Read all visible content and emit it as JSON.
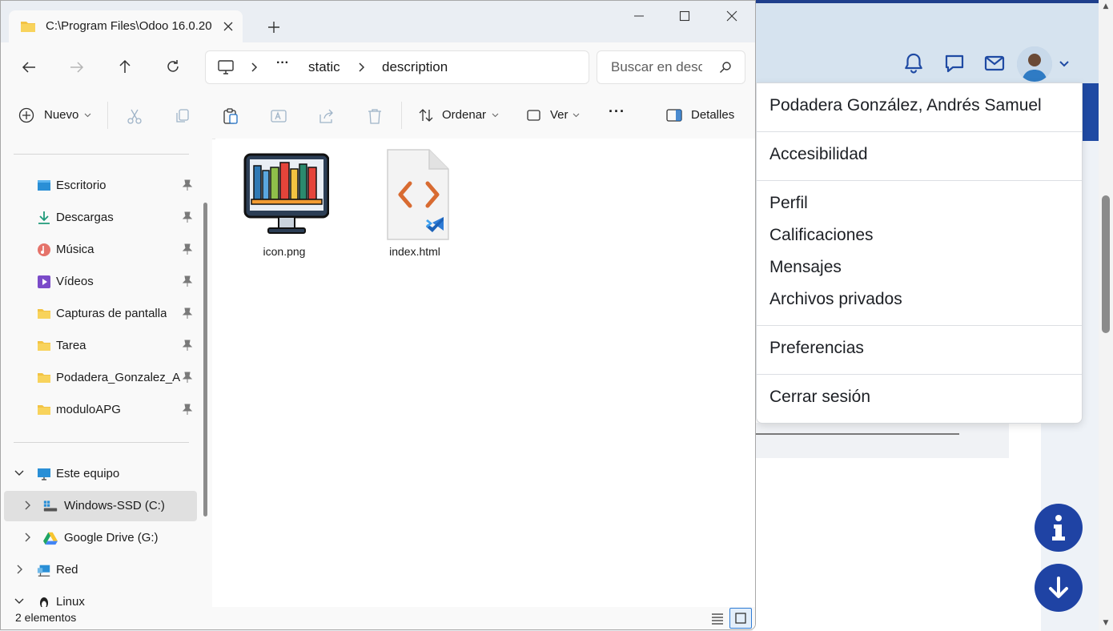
{
  "explorer": {
    "tab_title": "C:\\Program Files\\Odoo 16.0.20",
    "breadcrumb": [
      "static",
      "description"
    ],
    "breadcrumb_ellipsis": "···",
    "search_placeholder": "Buscar en desc",
    "toolbar": {
      "new": "Nuevo",
      "sort": "Ordenar",
      "view": "Ver",
      "more": "···",
      "details": "Detalles"
    },
    "quick_access": [
      {
        "label": "Escritorio",
        "icon": "desktop-icon"
      },
      {
        "label": "Descargas",
        "icon": "download-icon"
      },
      {
        "label": "Música",
        "icon": "music-icon"
      },
      {
        "label": "Vídeos",
        "icon": "video-icon"
      },
      {
        "label": "Capturas de pantalla",
        "icon": "folder-icon"
      },
      {
        "label": "Tarea",
        "icon": "folder-icon"
      },
      {
        "label": "Podadera_Gonzalez_Andres",
        "icon": "folder-icon"
      },
      {
        "label": "moduloAPG",
        "icon": "folder-icon"
      }
    ],
    "this_pc": "Este equipo",
    "drives": [
      {
        "label": "Windows-SSD (C:)",
        "icon": "windows-drive-icon",
        "selected": true
      },
      {
        "label": "Google Drive (G:)",
        "icon": "google-drive-icon",
        "selected": false
      }
    ],
    "network": "Red",
    "linux": "Linux",
    "files": [
      {
        "name": "icon.png",
        "icon": "bookshelf-monitor-thumbnail"
      },
      {
        "name": "index.html",
        "icon": "html-file-icon"
      }
    ],
    "status": "2 elementos"
  },
  "odoo": {
    "user_menu": {
      "user_name": "Podadera González, Andrés Samuel",
      "accessibility": "Accesibilidad",
      "profile": "Perfil",
      "grades": "Calificaciones",
      "messages": "Mensajes",
      "private_files": "Archivos privados",
      "preferences": "Preferencias",
      "logout": "Cerrar sesión"
    },
    "colors": {
      "header_bg": "#d6e3ef",
      "primary": "#1f43a4",
      "icon": "#1f4aa3"
    }
  }
}
